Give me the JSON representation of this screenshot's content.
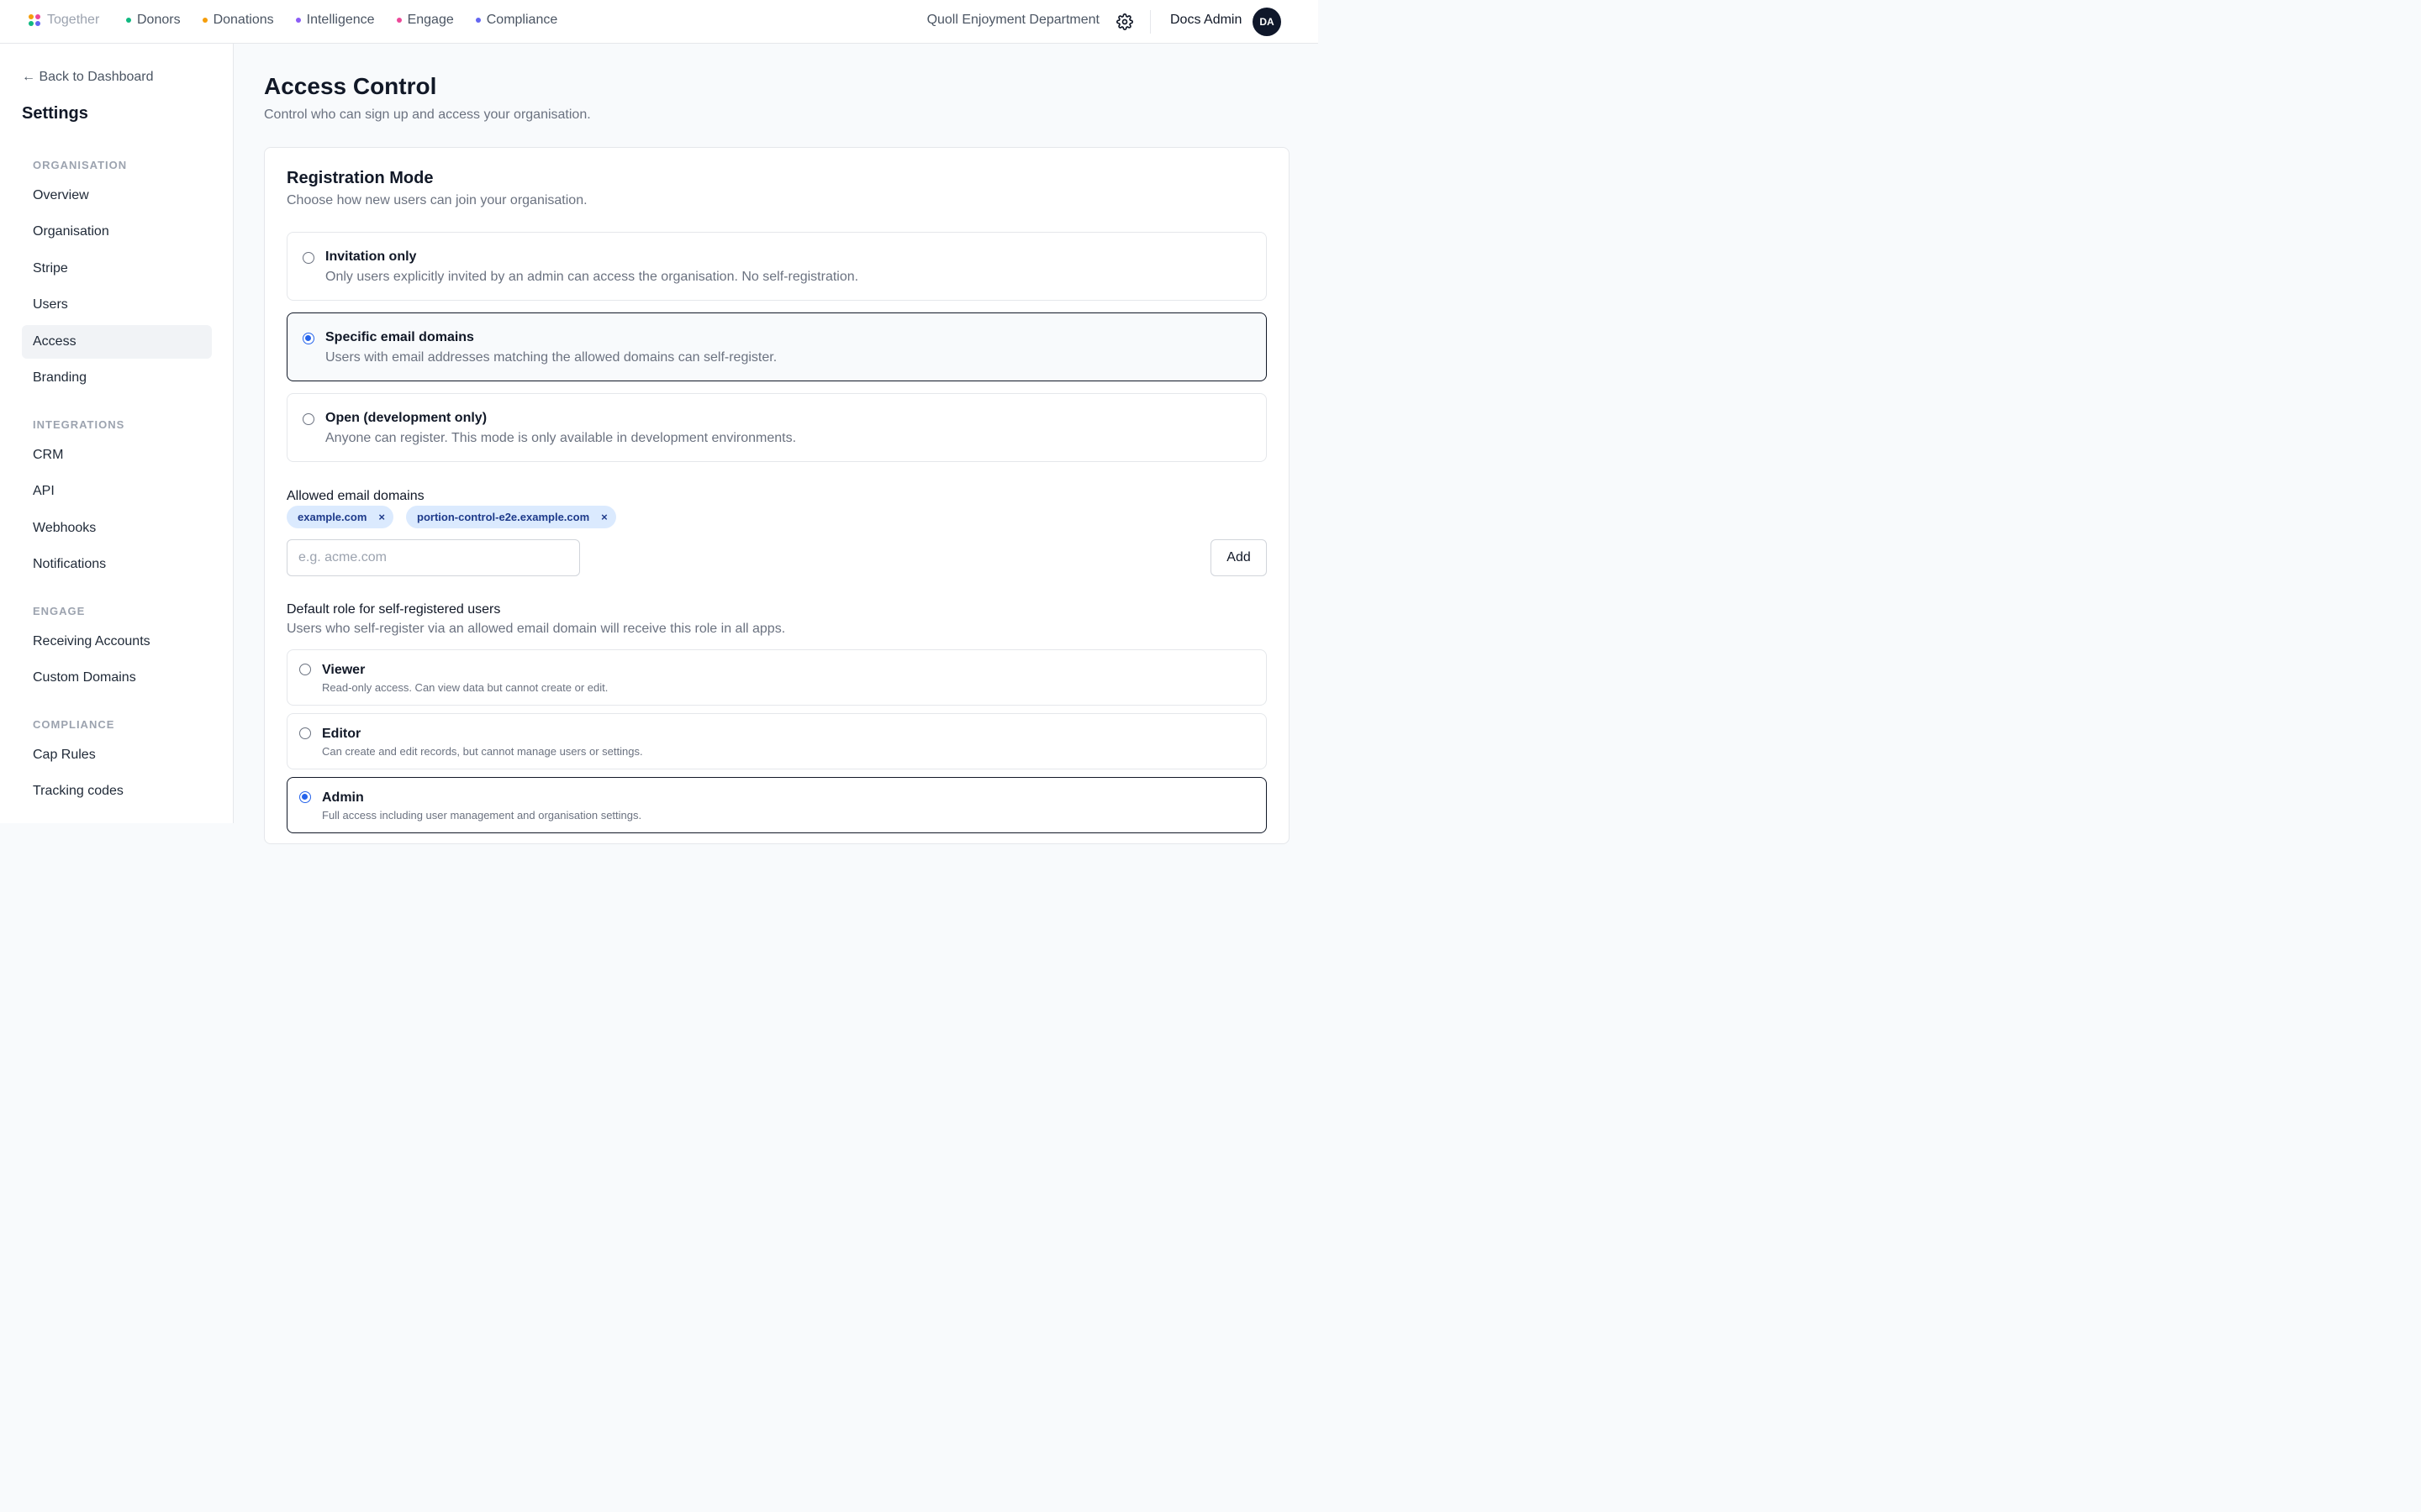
{
  "nav": {
    "brand": "Together",
    "links": [
      {
        "label": "Donors",
        "color": "#10b981"
      },
      {
        "label": "Donations",
        "color": "#f59e0b"
      },
      {
        "label": "Intelligence",
        "color": "#8b5cf6"
      },
      {
        "label": "Engage",
        "color": "#ec4899"
      },
      {
        "label": "Compliance",
        "color": "#6366f1"
      }
    ],
    "org_name": "Quoll Enjoyment Department",
    "user_name": "Docs Admin",
    "avatar_initials": "DA"
  },
  "sidebar": {
    "back_label": "← Back to Dashboard",
    "title": "Settings",
    "sections": [
      {
        "label": "ORGANISATION",
        "items": [
          "Overview",
          "Organisation",
          "Stripe",
          "Users",
          "Access",
          "Branding"
        ]
      },
      {
        "label": "INTEGRATIONS",
        "items": [
          "CRM",
          "API",
          "Webhooks",
          "Notifications"
        ]
      },
      {
        "label": "ENGAGE",
        "items": [
          "Receiving Accounts",
          "Custom Domains"
        ]
      },
      {
        "label": "COMPLIANCE",
        "items": [
          "Cap Rules",
          "Tracking codes"
        ]
      }
    ],
    "active_item": "Access"
  },
  "main": {
    "title": "Access Control",
    "subtitle": "Control who can sign up and access your organisation.",
    "registration": {
      "title": "Registration Mode",
      "subtitle": "Choose how new users can join your organisation.",
      "options": [
        {
          "label": "Invitation only",
          "description": "Only users explicitly invited by an admin can access the organisation. No self-registration."
        },
        {
          "label": "Specific email domains",
          "description": "Users with email addresses matching the allowed domains can self-register."
        },
        {
          "label": "Open (development only)",
          "description": "Anyone can register. This mode is only available in development environments."
        }
      ],
      "selected": "Specific email domains"
    },
    "domains": {
      "label": "Allowed email domains",
      "chips": [
        "example.com",
        "portion-control-e2e.example.com"
      ],
      "remove_glyph": "×",
      "input_placeholder": "e.g. acme.com",
      "input_value": "",
      "add_label": "Add"
    },
    "default_role": {
      "label": "Default role for self-registered users",
      "help": "Users who self-register via an allowed email domain will receive this role in all apps.",
      "options": [
        {
          "label": "Viewer",
          "description": "Read-only access. Can view data but cannot create or edit."
        },
        {
          "label": "Editor",
          "description": "Can create and edit records, but cannot manage users or settings."
        },
        {
          "label": "Admin",
          "description": "Full access including user management and organisation settings."
        }
      ],
      "selected": "Admin"
    }
  }
}
